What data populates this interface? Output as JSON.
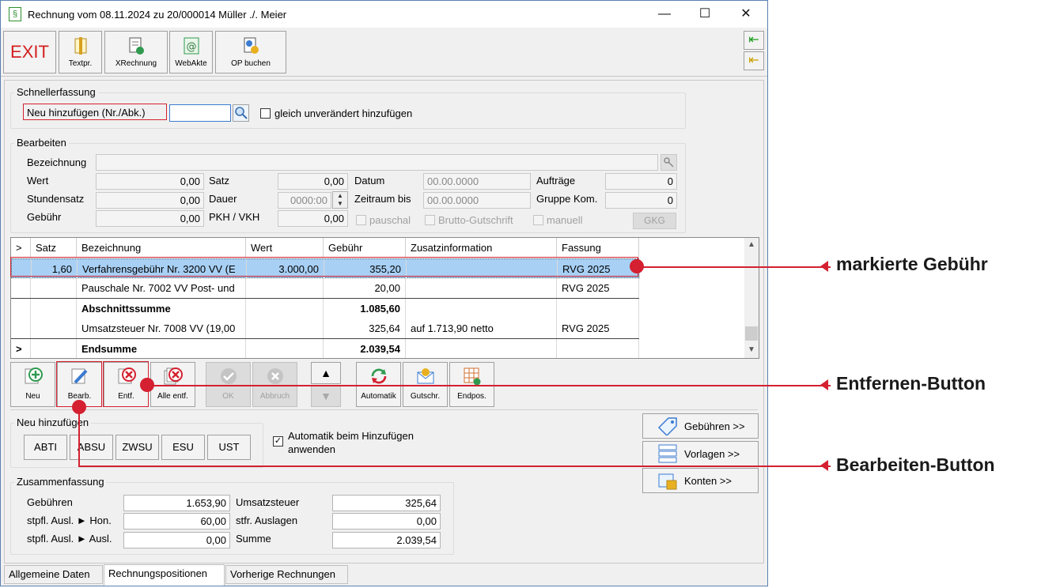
{
  "window": {
    "title": "Rechnung vom 08.11.2024 zu 20/000014  Müller ./. Meier",
    "app_icon": "§"
  },
  "toolbar": {
    "exit": "EXIT",
    "textpr": "Textpr.",
    "xrechnung": "XRechnung",
    "webakte": "WebAkte",
    "op_buchen": "OP buchen"
  },
  "schnellerfassung": {
    "title": "Schnellerfassung",
    "label": "Neu hinzufügen (Nr./Abk.)",
    "input_value": "",
    "checkbox_label": "gleich unverändert hinzufügen"
  },
  "bearbeiten": {
    "title": "Bearbeiten",
    "bezeichnung_label": "Bezeichnung",
    "wert_label": "Wert",
    "wert": "0,00",
    "stundensatz_label": "Stundensatz",
    "stundensatz": "0,00",
    "gebuehr_label": "Gebühr",
    "gebuehr": "0,00",
    "satz_label": "Satz",
    "satz": "0,00",
    "dauer_label": "Dauer",
    "dauer": "0000:00",
    "pkh_label": "PKH / VKH",
    "pkh": "0,00",
    "datum_label": "Datum",
    "datum": "00.00.0000",
    "zeitraum_label": "Zeitraum bis",
    "zeitraum": "00.00.0000",
    "auftraege_label": "Aufträge",
    "auftraege": "0",
    "gruppe_label": "Gruppe Kom.",
    "gruppe": "0",
    "pauschal": "pauschal",
    "brutto": "Brutto-Gutschrift",
    "manuell": "manuell",
    "gkg": "GKG"
  },
  "table": {
    "headers": [
      ">",
      "Satz",
      "Bezeichnung",
      "Wert",
      "Gebühr",
      "Zusatzinformation",
      "Fassung"
    ],
    "rows": [
      {
        "marker": "",
        "satz": "1,60",
        "bezeichnung": "Verfahrensgebühr Nr. 3200 VV (E",
        "wert": "3.000,00",
        "gebuehr": "355,20",
        "zusatz": "",
        "fassung": "RVG 2025"
      },
      {
        "marker": "",
        "satz": "",
        "bezeichnung": "Pauschale Nr. 7002 VV Post- und",
        "wert": "",
        "gebuehr": "20,00",
        "zusatz": "",
        "fassung": "RVG 2025"
      },
      {
        "marker": "",
        "satz": "",
        "bezeichnung": "Abschnittssumme",
        "wert": "",
        "gebuehr": "1.085,60",
        "zusatz": "",
        "fassung": ""
      },
      {
        "marker": "",
        "satz": "",
        "bezeichnung": "Umsatzsteuer Nr. 7008 VV (19,00",
        "wert": "",
        "gebuehr": "325,64",
        "zusatz": "auf 1.713,90 netto",
        "fassung": "RVG 2025"
      },
      {
        "marker": ">",
        "satz": "",
        "bezeichnung": "Endsumme",
        "wert": "",
        "gebuehr": "2.039,54",
        "zusatz": "",
        "fassung": ""
      }
    ]
  },
  "actions": {
    "neu": "Neu",
    "bearb": "Bearb.",
    "entf": "Entf.",
    "alle_entf": "Alle entf.",
    "ok": "OK",
    "abbruch": "Abbruch",
    "automatik": "Automatik",
    "gutschr": "Gutschr.",
    "endpos": "Endpos."
  },
  "neu_hinzufuegen": {
    "title": "Neu hinzufügen",
    "buttons": [
      "ABTI",
      "ABSU",
      "ZWSU",
      "ESU",
      "UST"
    ],
    "automatik_label_1": "Automatik beim Hinzufügen",
    "automatik_label_2": "anwenden"
  },
  "right_buttons": {
    "gebuehren": "Gebühren >>",
    "vorlagen": "Vorlagen >>",
    "konten": "Konten >>"
  },
  "zusammenfassung": {
    "title": "Zusammenfassung",
    "gebuehren_label": "Gebühren",
    "gebuehren": "1.653,90",
    "stpfl_hon_label": "stpfl. Ausl. ► Hon.",
    "stpfl_hon": "60,00",
    "stpfl_ausl_label": "stpfl. Ausl. ► Ausl.",
    "stpfl_ausl": "0,00",
    "ust_label": "Umsatzsteuer",
    "ust": "325,64",
    "stfr_label": "stfr. Auslagen",
    "stfr": "0,00",
    "summe_label": "Summe",
    "summe": "2.039,54"
  },
  "tabs": [
    "Allgemeine Daten",
    "Rechnungspositionen",
    "Vorherige Rechnungen"
  ],
  "callouts": {
    "markierte": "markierte Gebühr",
    "entfernen": "Entfernen-Button",
    "bearbeiten": "Bearbeiten-Button"
  },
  "colors": {
    "accent_red": "#d42030",
    "selection": "#a8d0f5",
    "icon_green": "#1a9a1a"
  }
}
